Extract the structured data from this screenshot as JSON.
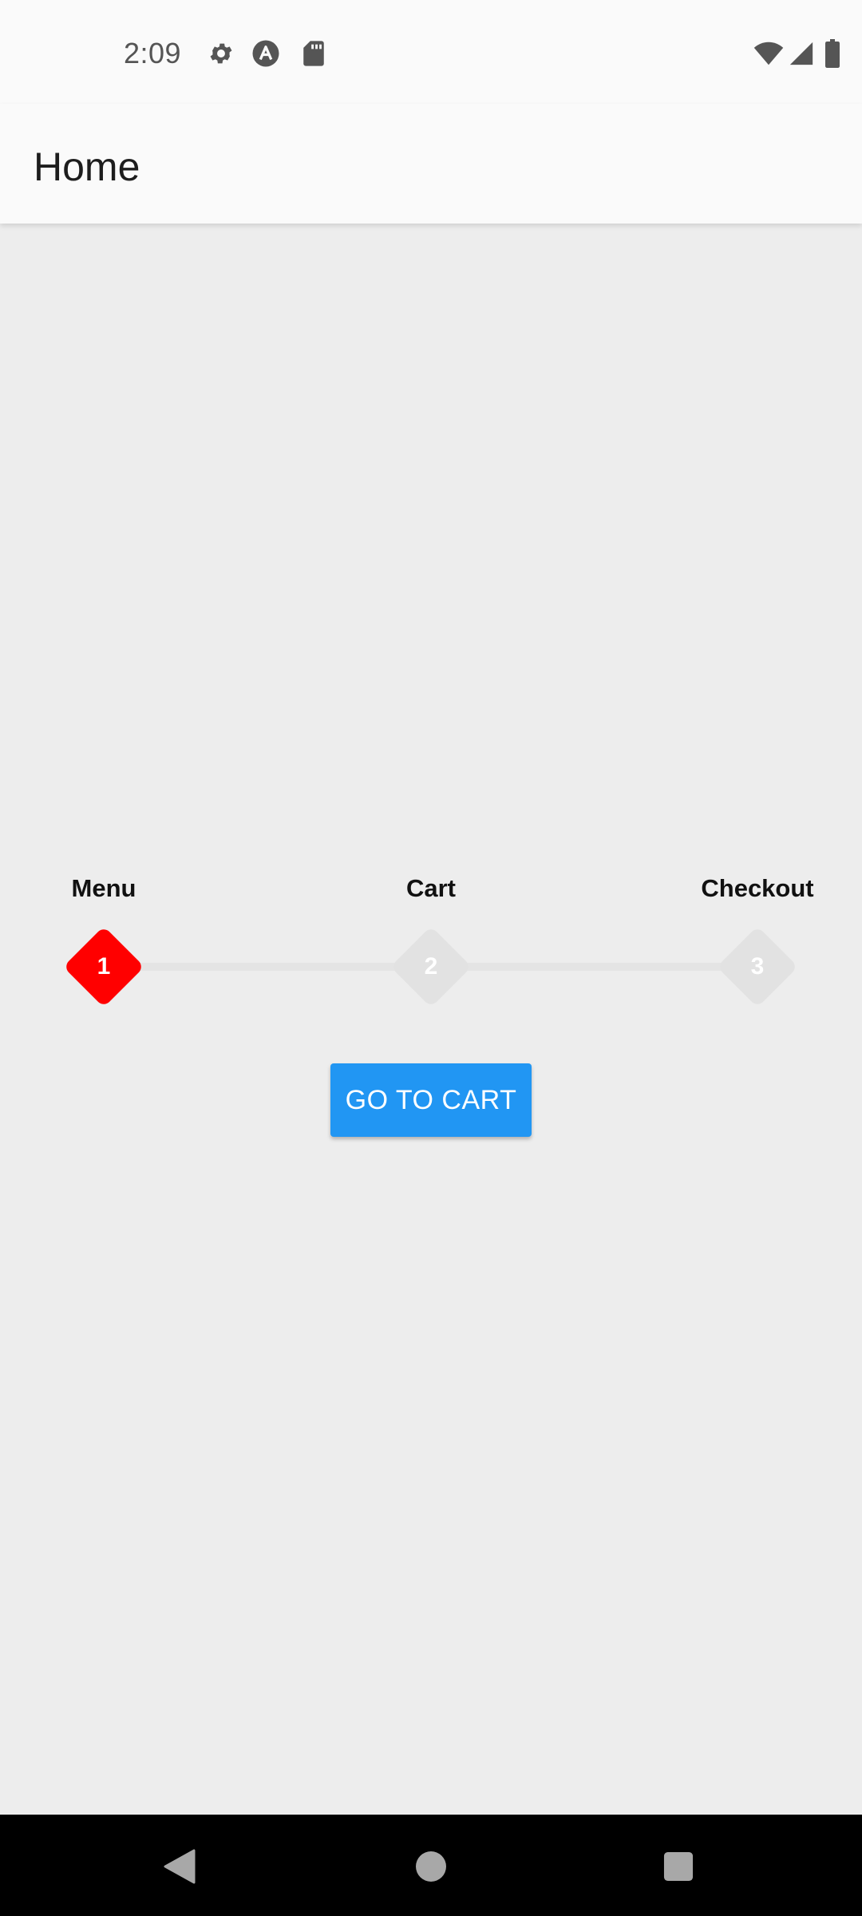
{
  "status_bar": {
    "time": "2:09",
    "left_icons": [
      "settings-gear-icon",
      "android-a-icon",
      "sd-card-icon"
    ],
    "right_icons": [
      "wifi-icon",
      "cell-signal-icon",
      "battery-icon"
    ]
  },
  "app_bar": {
    "title": "Home"
  },
  "stepper": {
    "active_color": "#ff0000",
    "inactive_color": "#e2e2e2",
    "steps": [
      {
        "label": "Menu",
        "number": "1",
        "active": true
      },
      {
        "label": "Cart",
        "number": "2",
        "active": false
      },
      {
        "label": "Checkout",
        "number": "3",
        "active": false
      }
    ]
  },
  "cta": {
    "label": "GO TO CART",
    "color": "#2196f3"
  },
  "nav_bar": {
    "buttons": [
      "back-icon",
      "home-icon",
      "recents-icon"
    ]
  }
}
